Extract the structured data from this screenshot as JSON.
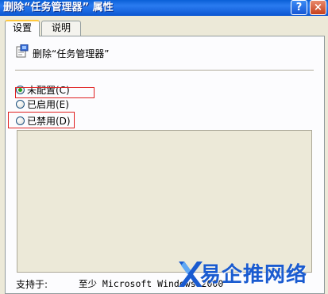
{
  "window": {
    "title": "删除“任务管理器” 属性",
    "help_button": "?",
    "close_button": "×"
  },
  "tabs": [
    {
      "label": "设置",
      "active": true
    },
    {
      "label": "说明",
      "active": false
    }
  ],
  "policy": {
    "icon": "policy-setting-icon",
    "name": "删除“任务管理器”"
  },
  "options": [
    {
      "label": "未配置(C)",
      "checked": true
    },
    {
      "label": "已启用(E)",
      "checked": false
    },
    {
      "label": "已禁用(D)",
      "checked": false
    }
  ],
  "supported": {
    "label": "支持于:",
    "value": "至少 Microsoft Windows 2000"
  },
  "watermark": {
    "text": "易企推网络"
  },
  "colors": {
    "titlebar": "#0b56d1",
    "highlight_box": "#e02020",
    "dialog_bg": "#ece9d8",
    "watermark": "#1a5bd0"
  }
}
